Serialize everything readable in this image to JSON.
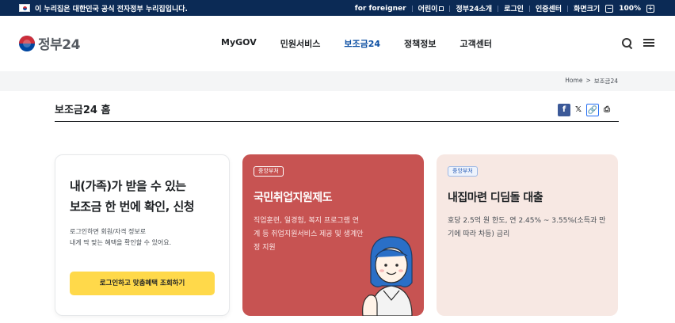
{
  "gov_bar": {
    "notice": "이 누리집은 대한민국 공식 전자정부 누리집입니다.",
    "links": [
      "for foreigner",
      "어린이",
      "정부24소개",
      "로그인",
      "인증센터"
    ],
    "zoom_label": "화면크기",
    "zoom_value": "100%",
    "zoom_minus": "−",
    "zoom_plus": "+"
  },
  "header": {
    "logo_text": "정부24",
    "nav": [
      "MyGOV",
      "민원서비스",
      "보조금24",
      "정책정보",
      "고객센터"
    ],
    "active_nav": "보조금24"
  },
  "breadcrumb": [
    "Home",
    ">",
    "보조금24"
  ],
  "page": {
    "title": "보조금24 홈"
  },
  "share": {
    "facebook": "f",
    "x": "𝕏",
    "link": "🔗",
    "print": "⎙"
  },
  "cards": {
    "intro": {
      "title_line1": "내(가족)가 받을 수 있는",
      "title_line2": "보조금 한 번에 확인, 신청",
      "desc_line1": "로그인하면 회원/자격 정보로",
      "desc_line2": "내게 딱 맞는 혜택을 확인할 수 있어요.",
      "button": "로그인하고 맞춤혜택 조회하기"
    },
    "job": {
      "badge": "중앙부처",
      "title": "국민취업지원제도",
      "desc": "직업훈련, 일경험, 복지 프로그램 연계 등 취업지원서비스 제공 및 생계안정 지원"
    },
    "loan": {
      "badge": "중앙부처",
      "title": "내집마련 디딤돌 대출",
      "desc": "호당 2.5억 원 한도, 연 2.45% ~ 3.55%(소득과 만기에 따라 차등) 금리"
    }
  },
  "colors": {
    "gov_bar": "#0b2a55",
    "accent": "#0b4ea2",
    "button_yellow": "#ffd94a",
    "card_red": "#c75352",
    "card_pink": "#f7e8e3"
  }
}
